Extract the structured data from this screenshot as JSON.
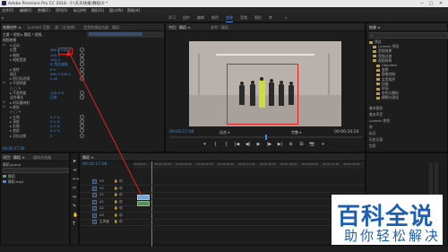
{
  "window": {
    "title": "Adobe Premiere Pro CC 2018 - F:\\天天快报\\舞蹈\\0 *",
    "min": "─",
    "max": "□",
    "close": "✕"
  },
  "menu": [
    "文件(F)",
    "编辑(E)",
    "剪辑(C)",
    "序列(S)",
    "标记(M)",
    "图形(G)",
    "窗口(W)",
    "帮助(H)"
  ],
  "workspaces": [
    "学习",
    "组件",
    "编辑",
    "颜色",
    "效果",
    "音频",
    "图形",
    "库"
  ],
  "active_workspace": "效果",
  "effect_controls": {
    "tabs": [
      "效果控件 ≡",
      "Lumetri 范围",
      "源：(无剪辑)",
      "音频剪辑混合器：舞蹈"
    ],
    "header": "主要 * 视频 ▸ 舞蹈 * 视频...",
    "section_video": "视频效果",
    "rows": [
      {
        "fx": "fx",
        "label": "▾ 运动",
        "value": ""
      },
      {
        "fx": "",
        "label": "位置",
        "value": "960.0  540.0"
      },
      {
        "fx": "",
        "label": "▸ 缩放",
        "value": "100.0"
      },
      {
        "fx": "",
        "label": "▸ 缩放宽度",
        "value": "100.0"
      },
      {
        "fx": "",
        "label": "",
        "value": "☑ 等比缩放"
      },
      {
        "fx": "",
        "label": "▸ 旋转",
        "value": "0.0"
      },
      {
        "fx": "",
        "label": "锚点",
        "value": "960.0  540.0"
      },
      {
        "fx": "",
        "label": "▸ 防闪烁滤镜",
        "value": "0.00"
      },
      {
        "fx": "fx",
        "label": "▾ 不透明度",
        "value": ""
      },
      {
        "fx": "",
        "label": "○ □ ✎",
        "value": ""
      },
      {
        "fx": "",
        "label": "▸ 不透明度",
        "value": "100.0 %"
      },
      {
        "fx": "",
        "label": "混合模式",
        "value": "正常"
      },
      {
        "fx": "fx",
        "label": "▸ 时间重映射",
        "value": ""
      },
      {
        "fx": "fx",
        "label": "▾ 裁剪",
        "value": ""
      },
      {
        "fx": "",
        "label": "○ □ ✎",
        "value": ""
      },
      {
        "fx": "",
        "label": "▸ 左侧",
        "value": "0.0 %"
      },
      {
        "fx": "",
        "label": "▸ 顶部",
        "value": "0.0 %"
      },
      {
        "fx": "",
        "label": "▸ 右侧",
        "value": "0.0 %"
      },
      {
        "fx": "",
        "label": "▸ 底部",
        "value": "0.0 %"
      },
      {
        "fx": "",
        "label": "▸ 羽化边缘",
        "value": "0"
      }
    ],
    "footer_timecode": "00:00:17:06"
  },
  "program": {
    "tabs": [
      "节目：舞蹈 ≡",
      "参考：舞蹈"
    ],
    "timecode_left": "00:00:17:06",
    "zoom": "适合",
    "quality": "完整",
    "timecode_right": "00:00:34:24",
    "controls": [
      "▾",
      "{",
      "}",
      "|◀",
      "◀|",
      "▶",
      "|▶",
      "▶|",
      "⊕",
      "⊞",
      "📷",
      "+"
    ]
  },
  "effects_panel": {
    "tab": "效果 ≡",
    "search_placeholder": "",
    "items": [
      {
        "indent": 0,
        "folder": true,
        "label": "预设"
      },
      {
        "indent": 1,
        "folder": true,
        "label": "Lumetri 预设"
      },
      {
        "indent": 1,
        "folder": true,
        "label": "音频效果"
      },
      {
        "indent": 1,
        "folder": true,
        "label": "音频过渡"
      },
      {
        "indent": 1,
        "folder": true,
        "label": "视频效果"
      },
      {
        "indent": 2,
        "folder": true,
        "label": "Obsolete"
      },
      {
        "indent": 2,
        "folder": true,
        "label": "变换"
      },
      {
        "indent": 2,
        "folder": true,
        "label": "图像控制"
      },
      {
        "indent": 2,
        "folder": true,
        "label": "实用程序"
      },
      {
        "indent": 2,
        "folder": true,
        "label": "扭曲"
      },
      {
        "indent": 2,
        "folder": true,
        "label": "时间"
      },
      {
        "indent": 2,
        "folder": true,
        "label": "杂色与颗粒"
      },
      {
        "indent": 2,
        "folder": true,
        "label": "模糊与锐化"
      }
    ],
    "sections": [
      "基本图形",
      "基本声音",
      "Lumetri 颜色",
      "库",
      "标记",
      "历史记录",
      "信息"
    ]
  },
  "project": {
    "tabs": [
      "项目：舞蹈 ≡",
      "媒体浏览器"
    ],
    "items": [
      "舞蹈.prproj",
      "舞蹈",
      "舞蹈.mp4"
    ]
  },
  "timeline": {
    "tab": "舞蹈 ≡",
    "timecode": "00:00:17:06",
    "ruler": [
      "00:00:00",
      "00:00:15:00",
      "00:00:30:00",
      "00:00:45:00",
      "00:01:00:00",
      "00:01:15:00",
      "00:01:30:00",
      "00:01:45:00",
      "00:02:00:00",
      "00:02:15:00",
      "00:02:30:00"
    ],
    "tracks": [
      "V3",
      "V2",
      "V1",
      "A1",
      "A2",
      "A3",
      "主声道"
    ],
    "master_value": "0.0"
  },
  "watermark": {
    "title": "百科全说",
    "subtitle": "助你轻松解决"
  },
  "colors": {
    "accent": "#3c8cdc",
    "highlight_red": "#e02020",
    "clip": "#7aa3d6",
    "watermark_blue": "#1a5fb4"
  }
}
